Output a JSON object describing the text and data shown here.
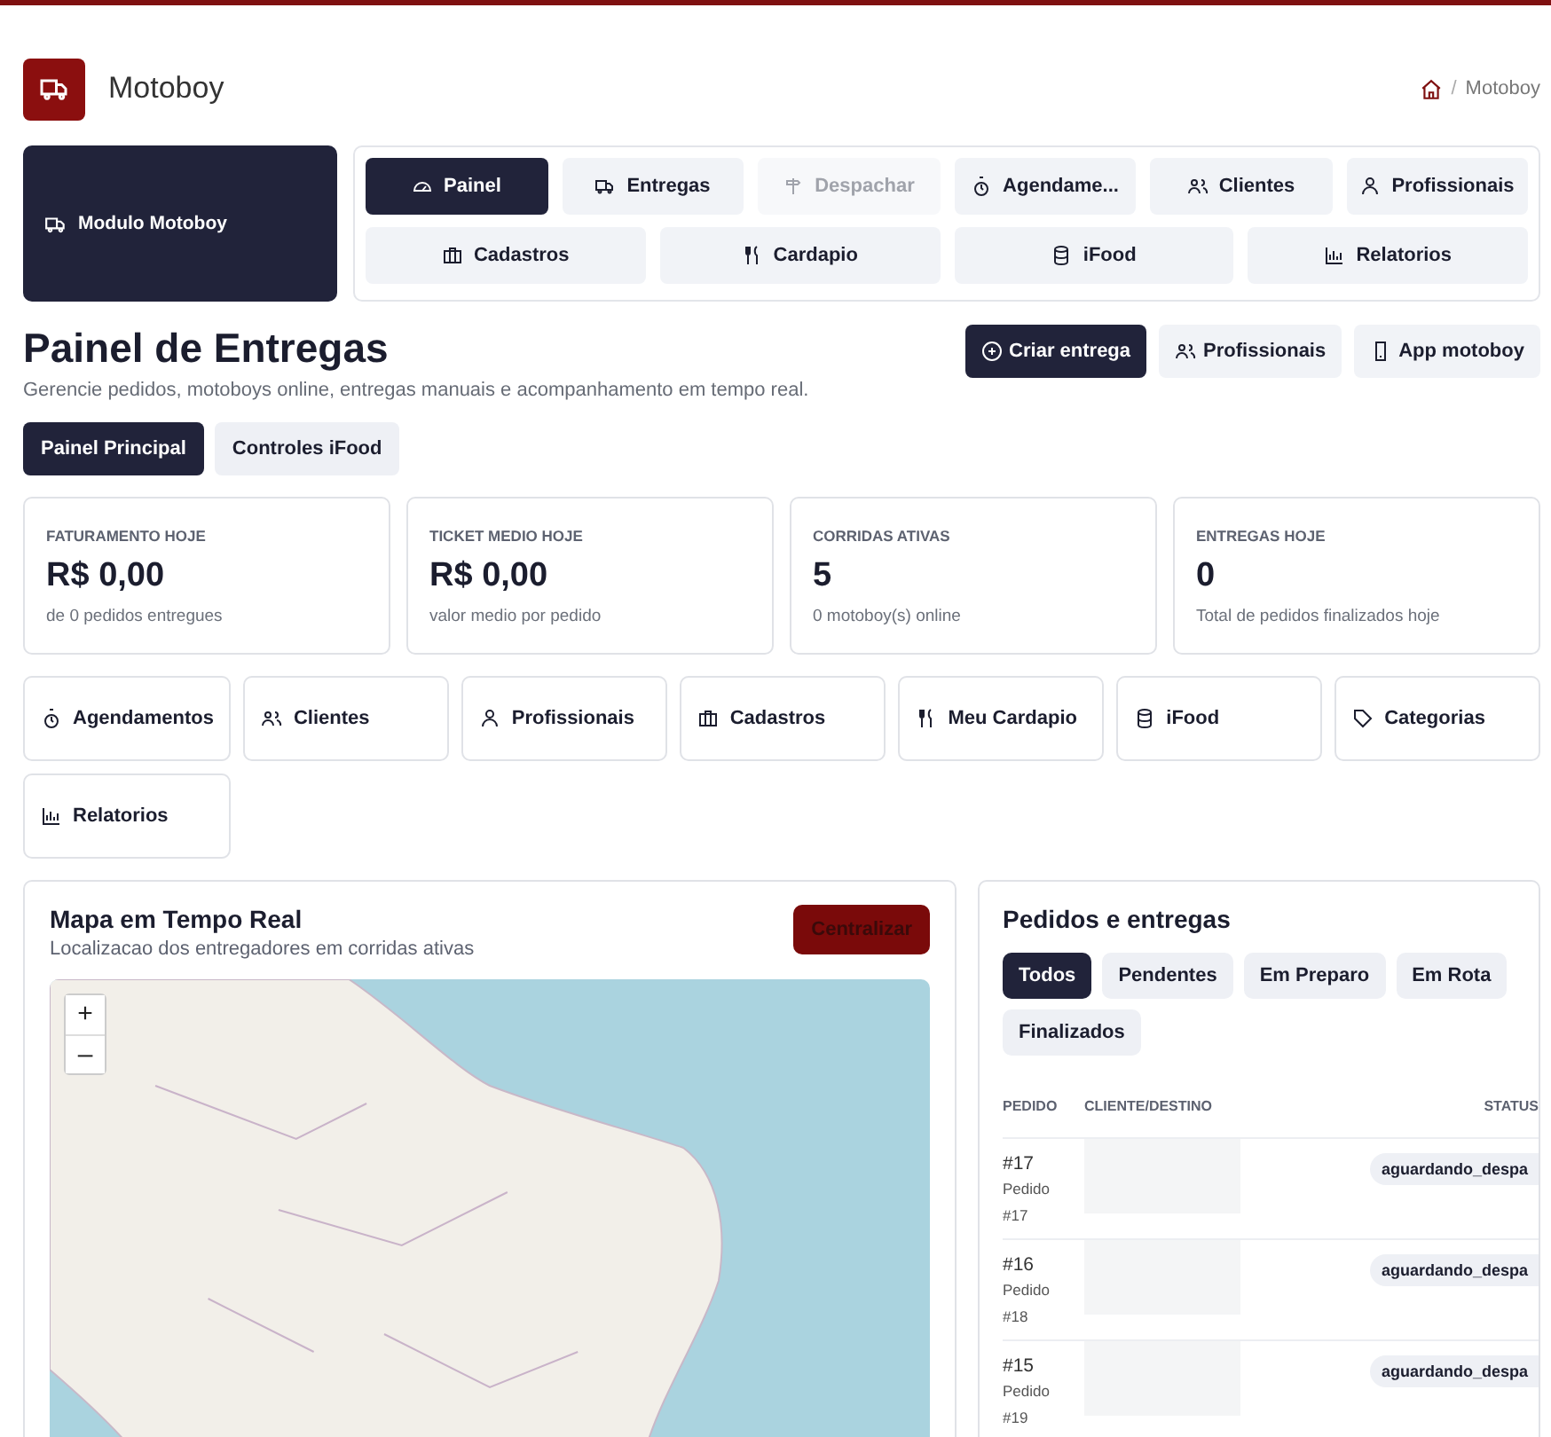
{
  "header": {
    "title": "Motoboy",
    "breadcrumb_separator": "/",
    "breadcrumb": [
      "Motoboy"
    ]
  },
  "module": {
    "label": "Modulo Motoboy"
  },
  "nav": {
    "rows": [
      {
        "items": [
          {
            "label": "Painel",
            "selected": true,
            "disabled": false
          },
          {
            "label": "Entregas",
            "selected": false,
            "disabled": false
          },
          {
            "label": "Despachar",
            "selected": false,
            "disabled": true
          },
          {
            "label": "Agendame...",
            "selected": false,
            "disabled": false
          },
          {
            "label": "Clientes",
            "selected": false,
            "disabled": false
          },
          {
            "label": "Profissionais",
            "selected": false,
            "disabled": false
          }
        ]
      },
      {
        "items": [
          {
            "label": "Cadastros",
            "selected": false,
            "disabled": false
          },
          {
            "label": "Cardapio",
            "selected": false,
            "disabled": false
          },
          {
            "label": "iFood",
            "selected": false,
            "disabled": false
          },
          {
            "label": "Relatorios",
            "selected": false,
            "disabled": false
          }
        ]
      }
    ]
  },
  "page": {
    "title": "Painel de Entregas",
    "subtitle": "Gerencie pedidos, motoboys online, entregas manuais e acompanhamento em tempo real.",
    "actions": [
      {
        "label": "Criar entrega",
        "kind": "primary"
      },
      {
        "label": "Profissionais",
        "kind": "secondary"
      },
      {
        "label": "App motoboy",
        "kind": "secondary"
      }
    ]
  },
  "tabs": [
    {
      "label": "Painel Principal",
      "selected": true
    },
    {
      "label": "Controles iFood",
      "selected": false
    }
  ],
  "stats": [
    {
      "label": "FATURAMENTO HOJE",
      "value": "R$ 0,00",
      "note": "de 0 pedidos entregues"
    },
    {
      "label": "TICKET MEDIO HOJE",
      "value": "R$ 0,00",
      "note": "valor medio por pedido"
    },
    {
      "label": "CORRIDAS ATIVAS",
      "value": "5",
      "note": "0 motoboy(s) online"
    },
    {
      "label": "ENTREGAS HOJE",
      "value": "0",
      "note": "Total de pedidos finalizados hoje"
    }
  ],
  "shortcuts": [
    "Agendamentos",
    "Clientes",
    "Profissionais",
    "Cadastros",
    "Meu Cardapio",
    "iFood",
    "Categorias",
    "Relatorios"
  ],
  "map": {
    "title": "Mapa em Tempo Real",
    "subtitle": "Localizacao dos entregadores em corridas ativas",
    "button": "Centralizar",
    "zoom_in": "+",
    "zoom_out": "–"
  },
  "orders": {
    "title": "Pedidos e entregas",
    "filters": [
      {
        "label": "Todos",
        "selected": true
      },
      {
        "label": "Pendentes",
        "selected": false
      },
      {
        "label": "Em Preparo",
        "selected": false
      },
      {
        "label": "Em Rota",
        "selected": false
      },
      {
        "label": "Finalizados",
        "selected": false
      }
    ],
    "columns": [
      "PEDIDO",
      "CLIENTE/DESTINO",
      "STATUS"
    ],
    "rows": [
      {
        "number": "#17",
        "description": "Pedido #17",
        "status": "aguardando_despa"
      },
      {
        "number": "#16",
        "description": "Pedido #18",
        "status": "aguardando_despa"
      },
      {
        "number": "#15",
        "description": "Pedido #19",
        "status": "aguardando_despa"
      }
    ]
  }
}
